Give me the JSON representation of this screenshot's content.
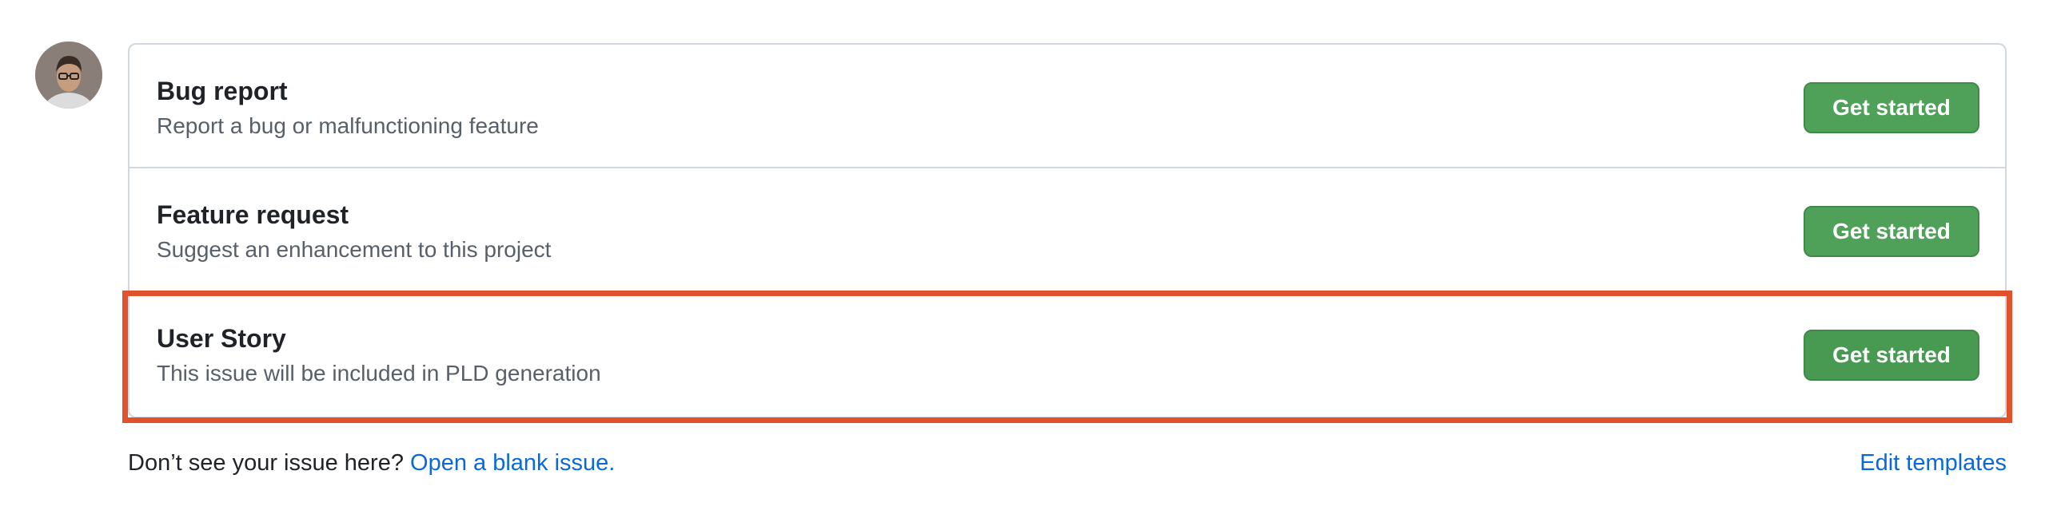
{
  "avatar": {
    "icon": "user-avatar"
  },
  "templates": [
    {
      "title": "Bug report",
      "description": "Report a bug or malfunctioning feature",
      "button_label": "Get started"
    },
    {
      "title": "Feature request",
      "description": "Suggest an enhancement to this project",
      "button_label": "Get started"
    },
    {
      "title": "User Story",
      "description": "This issue will be included in PLD generation",
      "button_label": "Get started",
      "highlighted": true
    }
  ],
  "footer": {
    "prompt": "Don’t see your issue here?",
    "blank_issue_link": "Open a blank issue.",
    "edit_templates_link": "Edit templates"
  },
  "colors": {
    "button_green": "#4fa15a",
    "link_blue": "#0969da",
    "highlight_red": "#e0512d",
    "border_gray": "#d0d7de",
    "muted_text": "#57606a"
  }
}
